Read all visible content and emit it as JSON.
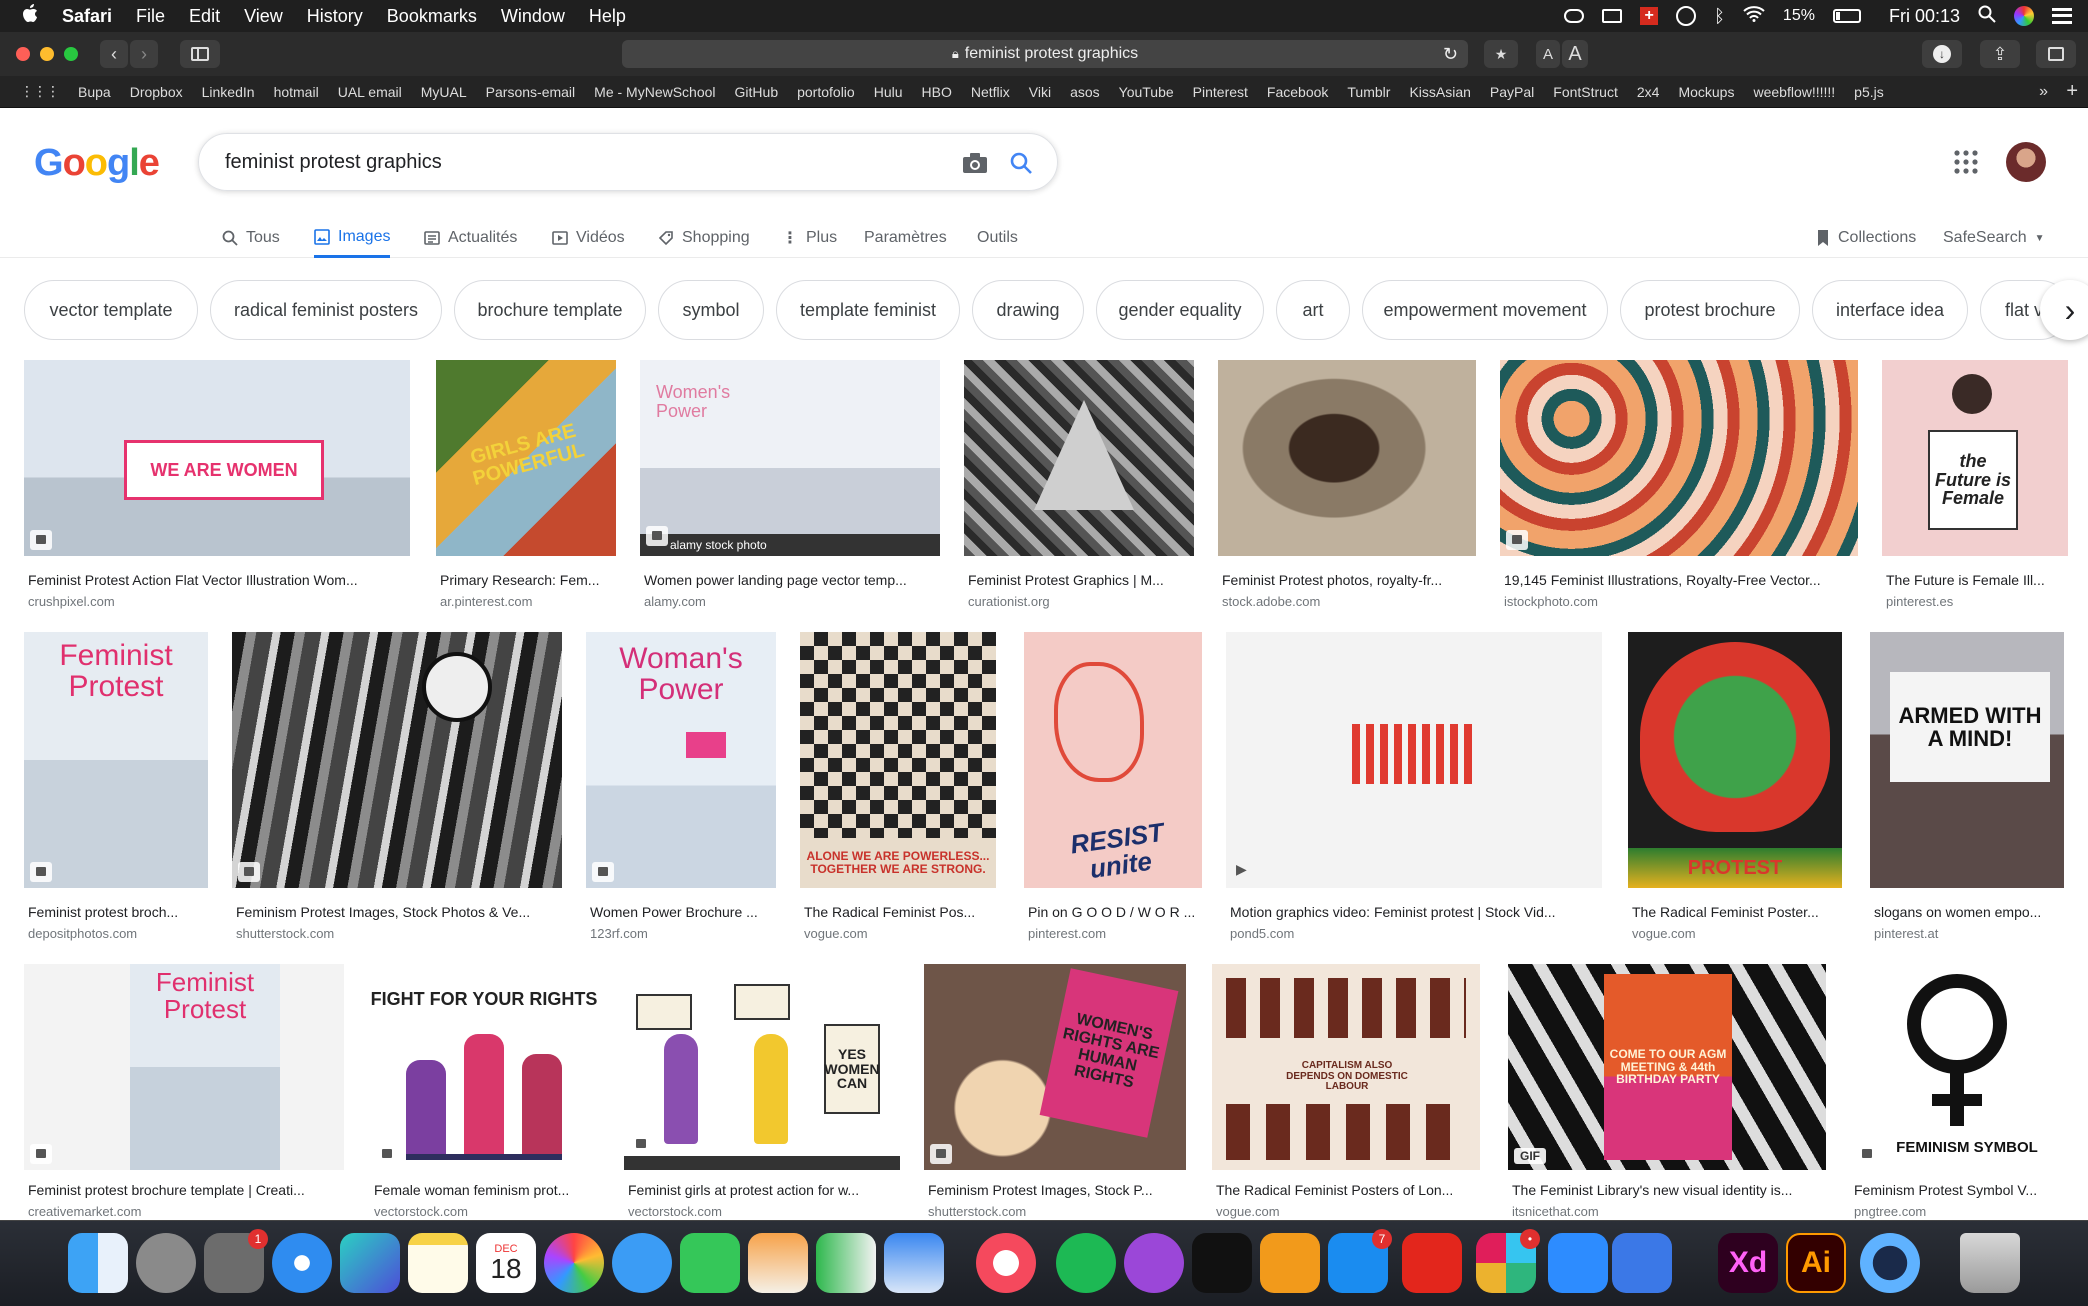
{
  "menubar": {
    "app": "Safari",
    "items": [
      "File",
      "Edit",
      "View",
      "History",
      "Bookmarks",
      "Window",
      "Help"
    ],
    "battery": "15%",
    "clock": "Fri 00:13"
  },
  "browser": {
    "url": "feminist protest graphics",
    "favorites": [
      "Bupa",
      "Dropbox",
      "LinkedIn",
      "hotmail",
      "UAL email",
      "MyUAL",
      "Parsons-email",
      "Me - MyNewSchool",
      "GitHub",
      "portofolio",
      "Hulu",
      "HBO",
      "Netflix",
      "Viki",
      "asos",
      "YouTube",
      "Pinterest",
      "Facebook",
      "Tumblr",
      "KissAsian",
      "PayPal",
      "FontStruct",
      "2x4",
      "Mockups",
      "weebflow!!!!!!",
      "p5.js"
    ]
  },
  "google": {
    "logo": "Google",
    "query": "feminist protest graphics",
    "tabs": [
      "Tous",
      "Images",
      "Actualités",
      "Vidéos",
      "Shopping",
      "Plus",
      "Paramètres",
      "Outils"
    ],
    "collections": "Collections",
    "safesearch": "SafeSearch"
  },
  "chips": [
    "vector template",
    "radical feminist posters",
    "brochure template",
    "symbol",
    "template feminist",
    "drawing",
    "gender equality",
    "art",
    "empowerment movement",
    "protest brochure",
    "interface idea",
    "flat ve"
  ],
  "results": [
    {
      "title": "Feminist Protest Action Flat Vector Illustration Wom...",
      "source": "crushpixel.com",
      "bg": "#cfd8e3",
      "art": "WE ARE WOMEN"
    },
    {
      "title": "Primary Research: Fem...",
      "source": "ar.pinterest.com",
      "bg": "#6a8f3e",
      "art": "GIRLS ARE POWERFUL"
    },
    {
      "title": "Women power landing page vector temp...",
      "source": "alamy.com",
      "bg": "#e5e9f0",
      "art": "Women's Power"
    },
    {
      "title": "Feminist Protest Graphics | M...",
      "source": "curationist.org",
      "bg": "#8a8a8a",
      "art": ""
    },
    {
      "title": "Feminist Protest photos, royalty-fr...",
      "source": "stock.adobe.com",
      "bg": "#7a6a5a",
      "art": ""
    },
    {
      "title": "19,145 Feminist Illustrations, Royalty-Free Vector...",
      "source": "istockphoto.com",
      "bg": "#e88a4a",
      "art": ""
    },
    {
      "title": "The Future is Female Ill...",
      "source": "pinterest.es",
      "bg": "#f0c9c9",
      "art": "the Future is Female"
    },
    {
      "title": "Feminist protest broch...",
      "source": "depositphotos.com",
      "bg": "#dfe6ee",
      "art": "Feminist Protest"
    },
    {
      "title": "Feminism Protest Images, Stock Photos & Ve...",
      "source": "shutterstock.com",
      "bg": "#5a5a5a",
      "art": ""
    },
    {
      "title": "Women Power Brochure ...",
      "source": "123rf.com",
      "bg": "#dbe7f2",
      "art": "Woman's Power"
    },
    {
      "title": "The Radical Feminist Pos...",
      "source": "vogue.com",
      "bg": "#d8cfc2",
      "art": "ALONE WE ARE POWERLESS... TOGETHER WE ARE STRONG."
    },
    {
      "title": "Pin on G O O D / W O R ...",
      "source": "pinterest.com",
      "bg": "#f3c6c0",
      "art": "RESIST unite"
    },
    {
      "title": "Motion graphics video: Feminist protest | Stock Vid...",
      "source": "pond5.com",
      "bg": "#f4f4f4",
      "art": ""
    },
    {
      "title": "The Radical Feminist Poster...",
      "source": "vogue.com",
      "bg": "#2f8a3a",
      "art": "PROTEST"
    },
    {
      "title": "slogans on women empo...",
      "source": "pinterest.at",
      "bg": "#9a9aa0",
      "art": "ARMED WITH A MIND!"
    },
    {
      "title": "Feminist protest brochure template | Creati...",
      "source": "creativemarket.com",
      "bg": "#e8edf2",
      "art": "Feminist Protest"
    },
    {
      "title": "Female woman feminism prot...",
      "source": "vectorstock.com",
      "bg": "#ffffff",
      "art": "FIGHT FOR YOUR RIGHTS"
    },
    {
      "title": "Feminist girls at protest action for w...",
      "source": "vectorstock.com",
      "bg": "#ffffff",
      "art": "YES WOMEN CAN"
    },
    {
      "title": "Feminism Protest Images, Stock P...",
      "source": "shutterstock.com",
      "bg": "#a88a7a",
      "art": "WOMEN'S RIGHTS ARE HUMAN RIGHTS"
    },
    {
      "title": "The Radical Feminist Posters of Lon...",
      "source": "vogue.com",
      "bg": "#f2e6da",
      "art": "CAPITALISM ALSO DEPENDS ON DOMESTIC LABOUR"
    },
    {
      "title": "The Feminist Library's new visual identity is...",
      "source": "itsnicethat.com",
      "bg": "#1a1a1a",
      "art": "COME TO OUR AGM MEETING & 44th BIRTHDAY PARTY"
    },
    {
      "title": "Feminism Protest Symbol V...",
      "source": "pngtree.com",
      "bg": "#ffffff",
      "art": "FEMINISM SYMBOL"
    }
  ],
  "overlays": {
    "alamy": "alamy stock photo",
    "gif": "GIF"
  },
  "dock": {
    "calendar_month": "DEC",
    "calendar_day": "18",
    "badges": {
      "settings": "1",
      "appstore": "7",
      "slack": "•"
    },
    "xd": "Xd",
    "ai": "Ai"
  }
}
